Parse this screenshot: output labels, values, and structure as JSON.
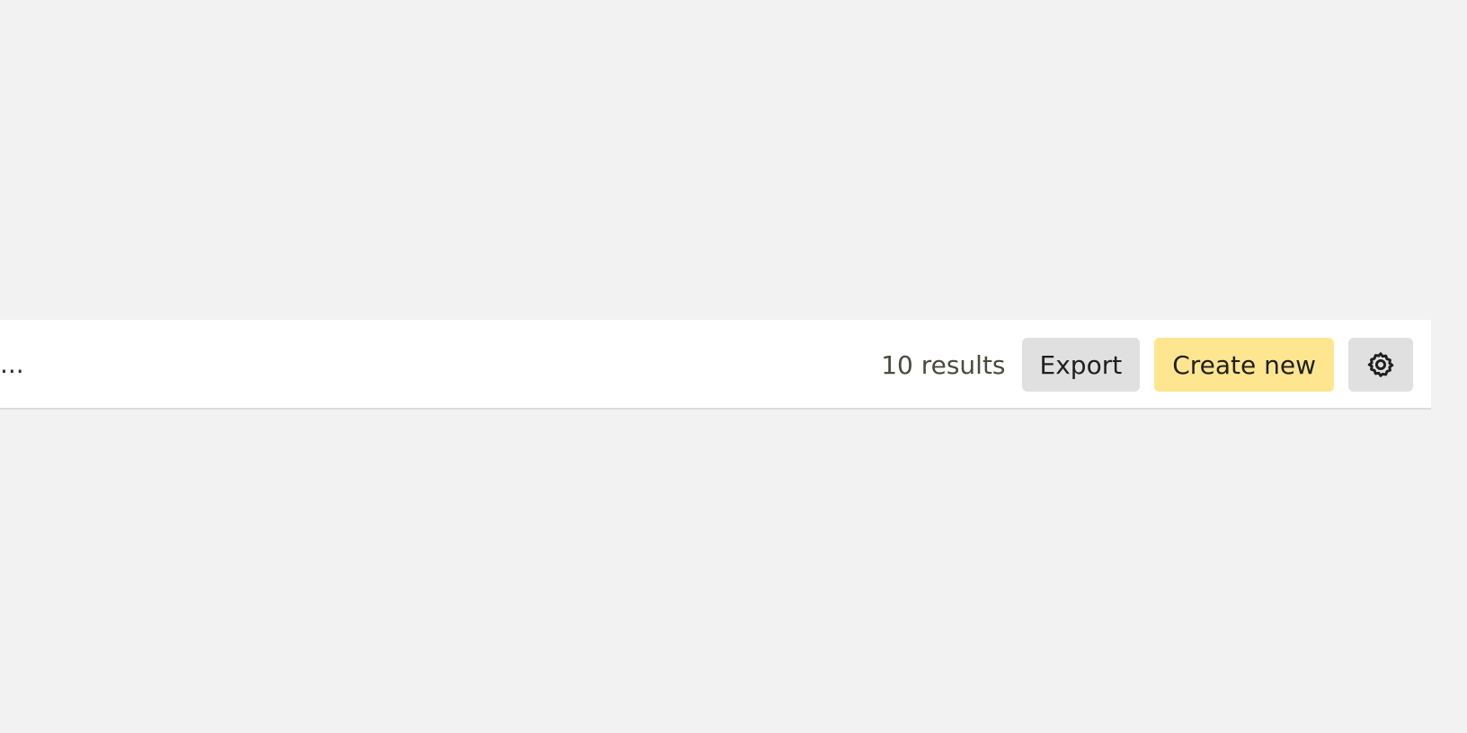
{
  "toolbar": {
    "truncated_text": "...",
    "result_count": "10 results",
    "export_label": "Export",
    "create_label": "Create new",
    "settings_icon": "gear-icon"
  },
  "colors": {
    "page_background": "#f2f2f2",
    "toolbar_background": "#ffffff",
    "secondary_button": "#e0e0e0",
    "primary_button": "#fde68f",
    "text": "#1f1f1f"
  }
}
